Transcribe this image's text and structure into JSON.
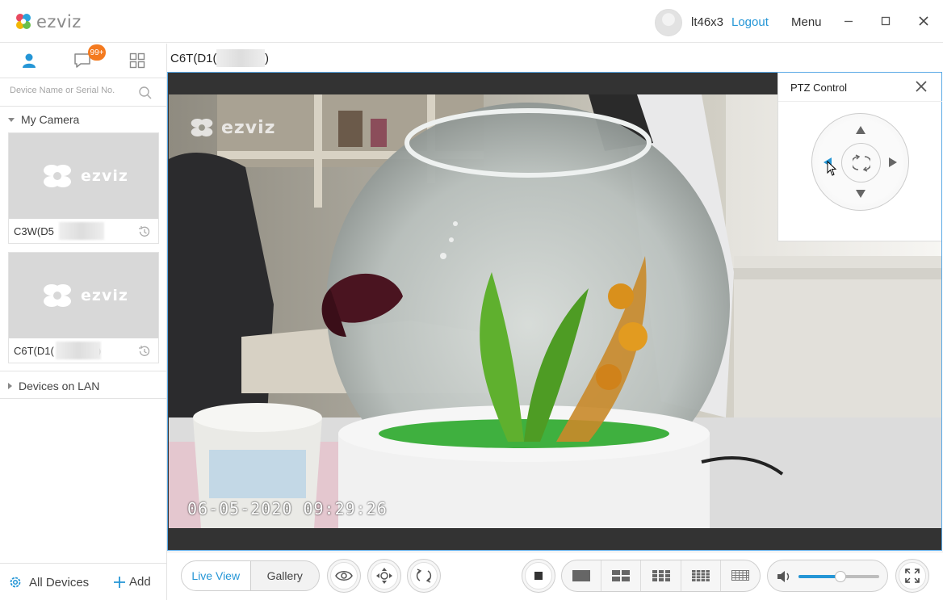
{
  "app": {
    "name": "ezviz"
  },
  "header": {
    "username": "lt46x3",
    "logout_label": "Logout",
    "menu_label": "Menu"
  },
  "sidebar": {
    "message_badge": "99+",
    "search_placeholder": "Device Name or Serial No.",
    "my_camera_label": "My Camera",
    "cameras": [
      {
        "name_prefix": "C3W(D5",
        "name_suffix": ")"
      },
      {
        "name_prefix": "C6T(D1(",
        "name_suffix": ")"
      }
    ],
    "lan_label": "Devices on LAN",
    "all_devices_label": "All Devices",
    "add_label": "Add"
  },
  "main": {
    "camera_title_prefix": "C6T(D1(",
    "camera_title_suffix": ")",
    "timestamp": "06-05-2020  09:29:26",
    "watermark": "ezviz"
  },
  "ptz": {
    "title": "PTZ Control"
  },
  "toolbar": {
    "live_view_label": "Live View",
    "gallery_label": "Gallery",
    "volume_level": 0.52
  },
  "colors": {
    "accent": "#2596d6",
    "badge": "#f47a1f"
  }
}
